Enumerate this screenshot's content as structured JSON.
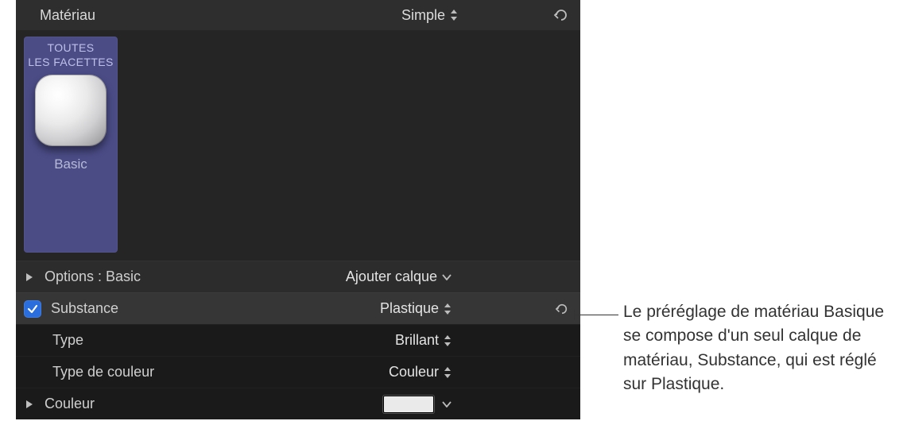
{
  "header": {
    "title": "Matériau",
    "preset": "Simple"
  },
  "swatch": {
    "top_label_line1": "TOUTES",
    "top_label_line2": "LES FACETTES",
    "name": "Basic"
  },
  "options": {
    "label": "Options : Basic",
    "add_layer": "Ajouter calque"
  },
  "substance": {
    "label": "Substance",
    "value": "Plastique"
  },
  "type_row": {
    "label": "Type",
    "value": "Brillant"
  },
  "color_type": {
    "label": "Type de couleur",
    "value": "Couleur"
  },
  "color_row": {
    "label": "Couleur",
    "swatch_hex": "#eaeaea"
  },
  "callout": {
    "text": "Le préréglage de matériau Basique se compose d'un seul calque de matériau, Substance, qui est réglé sur Plastique."
  }
}
